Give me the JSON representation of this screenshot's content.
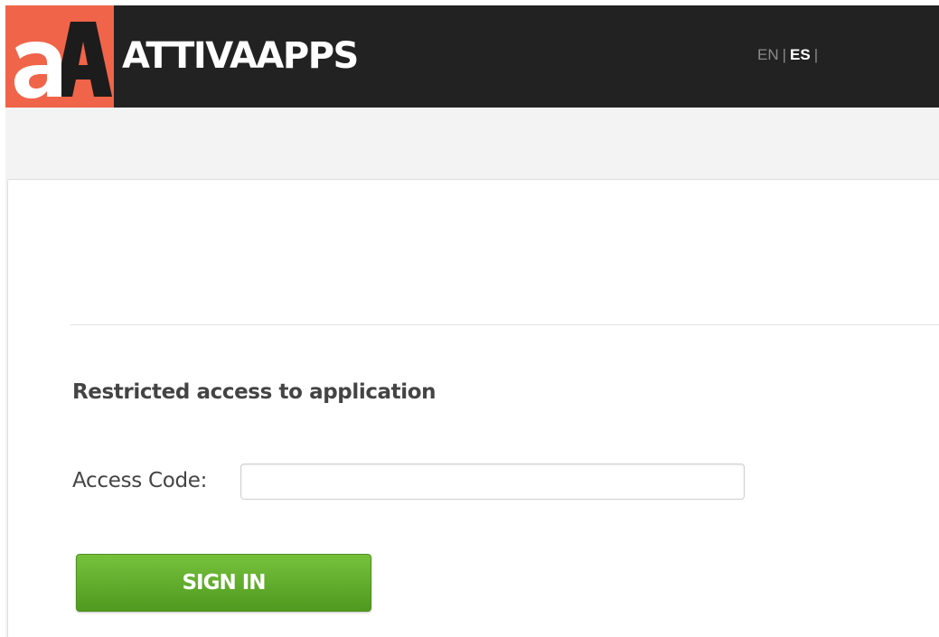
{
  "header": {
    "brand_name": "ATTIVAAPPS",
    "logo_icon": "attivaapps-logo-icon",
    "logo_color": "#f06449",
    "bar_color": "#222222",
    "language": {
      "en_label": "EN",
      "es_label": "ES",
      "separator": "|",
      "selected": "ES"
    }
  },
  "main": {
    "title": "Restricted access to application",
    "form": {
      "access_code_label": "Access Code:",
      "access_code_value": "",
      "access_code_placeholder": "",
      "submit_label": "SIGN IN",
      "submit_color": "#5fab2a"
    }
  }
}
